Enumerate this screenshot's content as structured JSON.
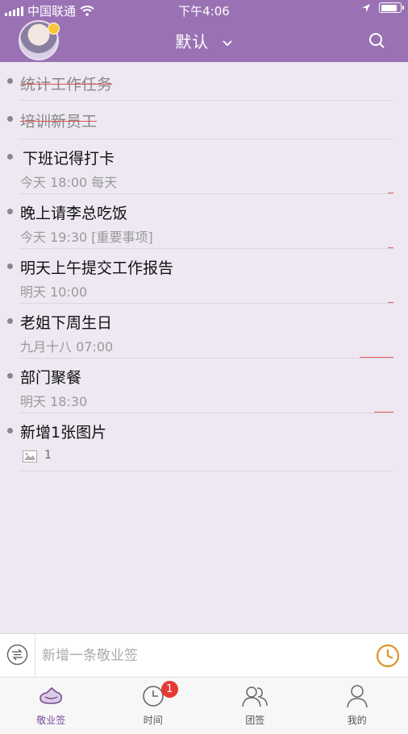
{
  "status_bar": {
    "carrier": "中国联通",
    "time": "下午4:06"
  },
  "header": {
    "title": "默认"
  },
  "tasks": [
    {
      "title": "统计工作任务",
      "done": true
    },
    {
      "title": "培训新员工",
      "done": true
    },
    {
      "title": "下班记得打卡",
      "sub": "今天 18:00  每天"
    },
    {
      "title": "晚上请李总吃饭",
      "sub": "今天 19:30  [重要事项]"
    },
    {
      "title": "明天上午提交工作报告",
      "sub": "明天 10:00"
    },
    {
      "title": "老姐下周生日",
      "sub": "九月十八 07:00"
    },
    {
      "title": "部门聚餐",
      "sub": "明天 18:30"
    },
    {
      "title": "新增1张图片",
      "image_count": "1"
    }
  ],
  "input_bar": {
    "placeholder": "新增一条敬业签"
  },
  "tabbar": {
    "tabs": [
      {
        "label": "敬业签",
        "active": true
      },
      {
        "label": "时间",
        "badge": "1"
      },
      {
        "label": "团签"
      },
      {
        "label": "我的"
      }
    ]
  },
  "colors": {
    "header": "#9a72b4",
    "background": "#ede8f2",
    "accent": "#7a4b96",
    "badge": "#e53935",
    "clock": "#d9962a"
  }
}
